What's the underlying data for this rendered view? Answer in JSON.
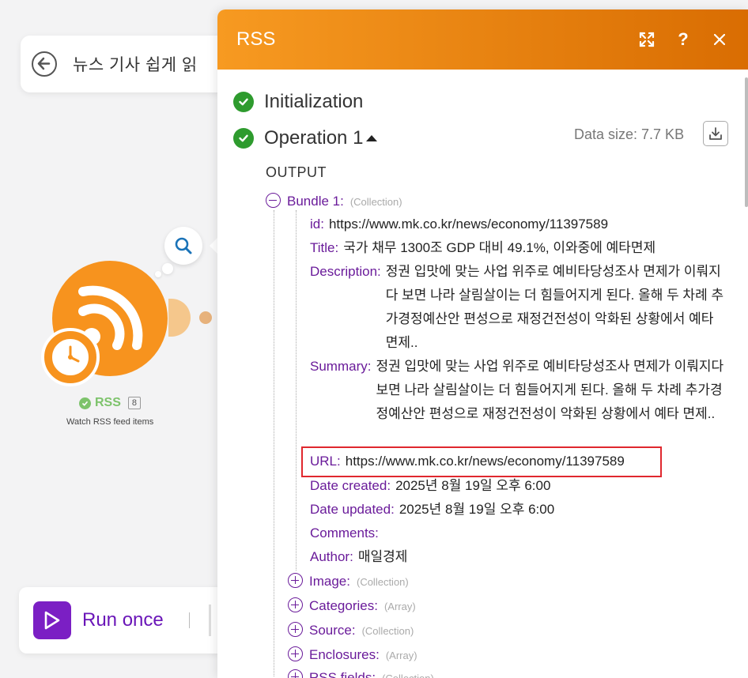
{
  "scenario": {
    "title": "뉴스 기사 쉽게 읽"
  },
  "module": {
    "name": "RSS",
    "badge": "8",
    "subtitle": "Watch RSS feed items"
  },
  "run": {
    "label": "Run once"
  },
  "panel": {
    "title": "RSS",
    "sections": {
      "initialization": "Initialization",
      "operation": "Operation 1"
    },
    "data_size": "Data size: 7.7 KB",
    "output_label": "OUTPUT",
    "bundle": {
      "label": "Bundle 1:",
      "type": "(Collection)",
      "fields": {
        "id": {
          "key": "id:",
          "value": "https://www.mk.co.kr/news/economy/11397589"
        },
        "title": {
          "key": "Title:",
          "value": "국가 채무 1300조 GDP 대비 49.1%, 이와중에 예타면제"
        },
        "description": {
          "key": "Description:",
          "value": "정권 입맛에 맞는 사업 위주로 예비타당성조사 면제가 이뤄지다 보면 나라 살림살이는 더 힘들어지게 된다. 올해 두 차례 추가경정예산안 편성으로 재정건전성이 악화된 상황에서 예타 면제.."
        },
        "summary": {
          "key": "Summary:",
          "value": "정권 입맛에 맞는 사업 위주로 예비타당성조사 면제가 이뤄지다 보면 나라 살림살이는 더 힘들어지게 된다. 올해 두 차례 추가경정예산안 편성으로 재정건전성이 악화된 상황에서 예타 면제.."
        },
        "url": {
          "key": "URL:",
          "value": "https://www.mk.co.kr/news/economy/11397589"
        },
        "date_created": {
          "key": "Date created:",
          "value": "2025년 8월 19일 오후 6:00"
        },
        "date_updated": {
          "key": "Date updated:",
          "value": "2025년 8월 19일 오후 6:00"
        },
        "comments": {
          "key": "Comments:",
          "value": ""
        },
        "author": {
          "key": "Author:",
          "value": "매일경제"
        }
      },
      "collapsed": {
        "image": {
          "key": "Image:",
          "type": "(Collection)"
        },
        "categories": {
          "key": "Categories:",
          "type": "(Array)"
        },
        "source": {
          "key": "Source:",
          "type": "(Collection)"
        },
        "enclosures": {
          "key": "Enclosures:",
          "type": "(Array)"
        },
        "rss_fields": {
          "key": "RSS fields:",
          "type": "(Collection)"
        }
      }
    }
  }
}
